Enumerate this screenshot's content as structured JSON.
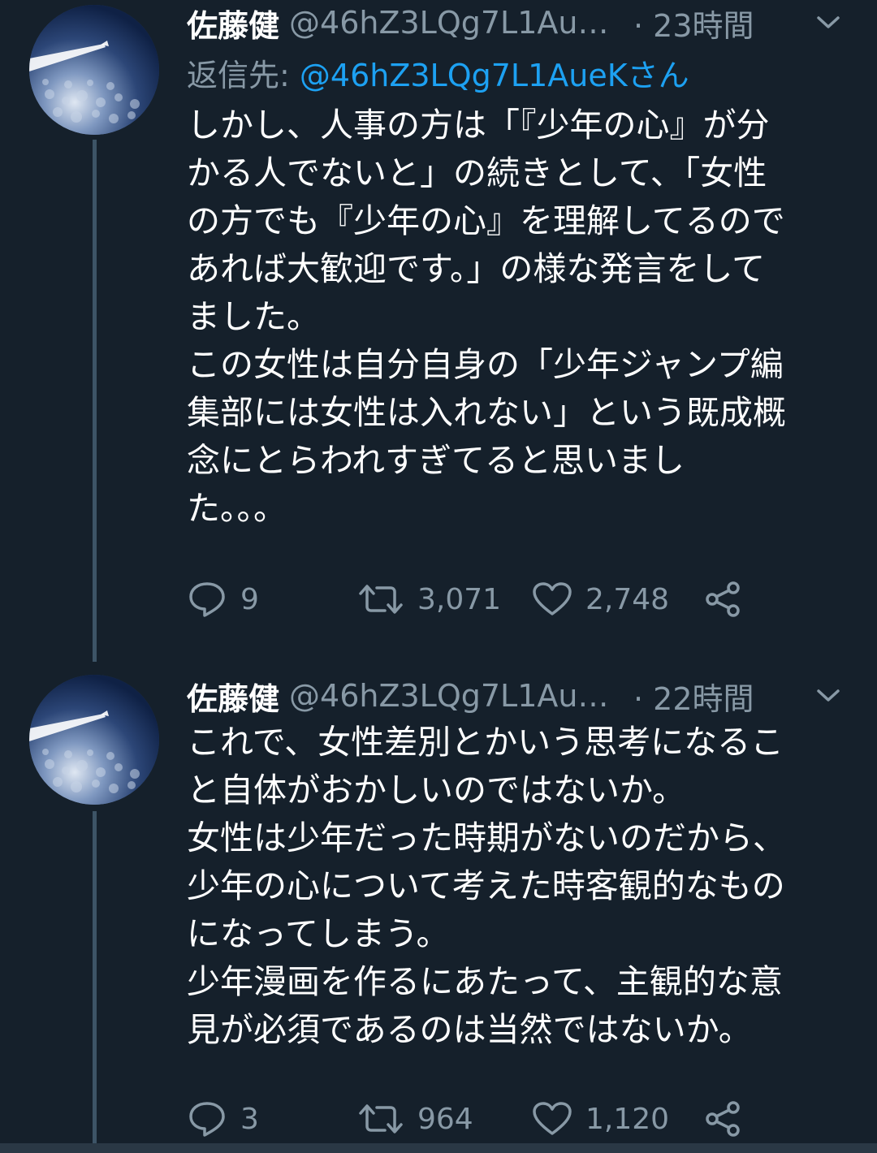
{
  "tweets": [
    {
      "display_name": "佐藤健",
      "handle": "@46hZ3LQg7L1Au…",
      "time": "· 23時間",
      "reply_prefix": "返信先: ",
      "reply_mention": "@46hZ3LQg7L1AueKさん",
      "text": "しかし、人事の方は「『少年の心』が分\nかる人でないと」の続きとして、「女性\nの方でも『少年の心』を理解してるので\nあれば大歓迎です。」の様な発言をして\nました。\nこの女性は自分自身の「少年ジャンプ編\n集部には女性は入れない」という既成概\n念にとらわれすぎてると思いまし\nた。。。",
      "replies": "9",
      "retweets": "3,071",
      "likes": "2,748"
    },
    {
      "display_name": "佐藤健",
      "handle": "@46hZ3LQg7L1Au…",
      "time": "· 22時間",
      "text": "これで、女性差別とかいう思考になるこ\nと自体がおかしいのではないか。\n女性は少年だった時期がないのだから、\n少年の心について考えた時客観的なもの\nになってしまう。\n少年漫画を作るにあたって、主観的な意\n見が必須であるのは当然ではないか。",
      "replies": "3",
      "retweets": "964",
      "likes": "1,120"
    }
  ],
  "icons": {
    "reply": "reply-icon",
    "retweet": "retweet-icon",
    "like": "heart-icon",
    "share": "share-icon",
    "menu": "chevron-down-icon"
  },
  "colors": {
    "background": "#15202b",
    "secondary_text": "#8899a6",
    "accent": "#1da1f2",
    "thread_line": "#3d5466"
  }
}
